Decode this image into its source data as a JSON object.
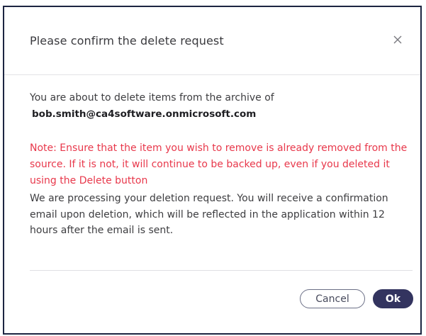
{
  "dialog": {
    "title": "Please confirm the delete request",
    "close_icon": "close-icon",
    "intro_text": "You are about to delete items from the archive of",
    "email": "bob.smith@ca4software.onmicrosoft.com",
    "note": "Note: Ensure that the item you wish to remove is already removed from the source. If it is not, it will continue to be backed up, even if you deleted it using the Delete button",
    "processing_text": "We are processing your deletion request. You will receive a confirmation email upon deletion, which will be reflected in the application within 12 hours after the email is sent.",
    "cancel_label": "Cancel",
    "ok_label": "Ok"
  },
  "colors": {
    "note_text": "#e8384b",
    "primary_button": "#33345f",
    "dialog_border": "#1c2541"
  }
}
